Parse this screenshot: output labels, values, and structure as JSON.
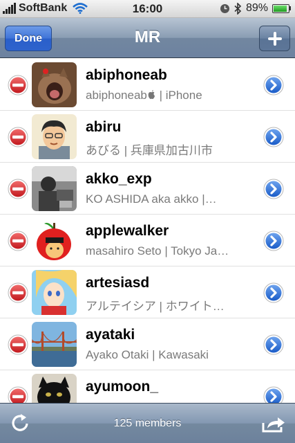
{
  "status_bar": {
    "carrier": "SoftBank",
    "time": "16:00",
    "battery": "89%",
    "icons": [
      "signal-icon",
      "wifi-icon",
      "clock-icon",
      "bluetooth-icon",
      "battery-icon"
    ]
  },
  "nav": {
    "title": "MR",
    "done_label": "Done",
    "add_icon": "plus-icon"
  },
  "members": [
    {
      "username": "abiphoneab",
      "subtitle": "abiphoneab | iPhone",
      "subtitle_icon": "apple-icon",
      "avatar": "avatar-cat"
    },
    {
      "username": "abiru",
      "subtitle": "あびる | 兵庫県加古川市",
      "avatar": "avatar-cartoon-man"
    },
    {
      "username": "akko_exp",
      "subtitle": "KO ASHIDA aka akko |…",
      "avatar": "avatar-photo-bw"
    },
    {
      "username": "applewalker",
      "subtitle": "masahiro Seto | Tokyo Ja…",
      "avatar": "avatar-apple"
    },
    {
      "username": "artesiasd",
      "subtitle": "アルテイシア | ホワイト…",
      "avatar": "avatar-anime"
    },
    {
      "username": "ayataki",
      "subtitle": "Ayako Otaki | Kawasaki",
      "avatar": "avatar-bridge"
    },
    {
      "username": "ayumoon_",
      "subtitle": "",
      "avatar": "avatar-black-cat"
    }
  ],
  "toolbar": {
    "members_label": "125 members",
    "left_icon": "refresh-icon",
    "right_icon": "share-icon"
  },
  "colors": {
    "nav_bar": "#7a8fa8",
    "done_button": "#3a6fd4",
    "delete_red": "#d2212a",
    "disclosure_blue": "#2a6fd6",
    "subtitle_gray": "#7a7a7a"
  }
}
